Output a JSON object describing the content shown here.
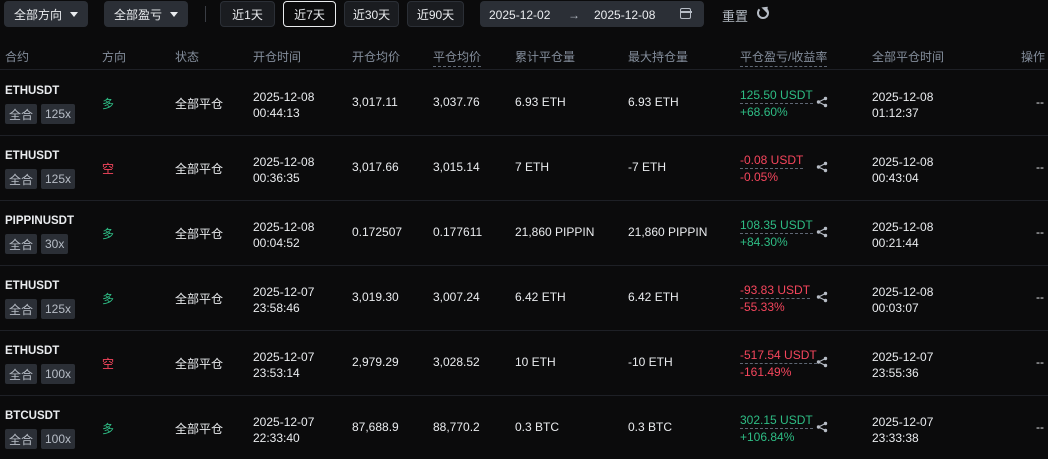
{
  "filters": {
    "direction": "全部方向",
    "pnl": "全部盈亏",
    "ranges": [
      "近1天",
      "近7天",
      "近30天",
      "近90天"
    ],
    "active_range": "近7天",
    "date_start": "2025-12-02",
    "date_end": "2025-12-08",
    "reset": "重置"
  },
  "headers": {
    "contract": "合约",
    "direction": "方向",
    "status": "状态",
    "open_time": "开仓时间",
    "open_avg": "开仓均价",
    "close_avg": "平仓均价",
    "cum_close_qty": "累计平仓量",
    "max_hold_qty": "最大持仓量",
    "close_pnl": "平仓盈亏/收益率",
    "full_close_time": "全部平仓时间",
    "action": "操作"
  },
  "rows": [
    {
      "symbol": "ETHUSDT",
      "margin": "全合",
      "leverage": "125x",
      "direction": "多",
      "side": "long",
      "status": "全部平仓",
      "open_date": "2025-12-08",
      "open_time": "00:44:13",
      "open_avg": "3,017.11",
      "close_avg": "3,037.76",
      "cum_qty": "6.93 ETH",
      "max_qty": "6.93 ETH",
      "pnl": "125.50 USDT",
      "roi": "+68.60%",
      "pnl_sign": "pos",
      "close_date": "2025-12-08",
      "close_time": "01:12:37",
      "action": "--"
    },
    {
      "symbol": "ETHUSDT",
      "margin": "全合",
      "leverage": "125x",
      "direction": "空",
      "side": "short",
      "status": "全部平仓",
      "open_date": "2025-12-08",
      "open_time": "00:36:35",
      "open_avg": "3,017.66",
      "close_avg": "3,015.14",
      "cum_qty": "7 ETH",
      "max_qty": "-7 ETH",
      "pnl": "-0.08 USDT",
      "roi": "-0.05%",
      "pnl_sign": "neg",
      "close_date": "2025-12-08",
      "close_time": "00:43:04",
      "action": "--"
    },
    {
      "symbol": "PIPPINUSDT",
      "margin": "全合",
      "leverage": "30x",
      "direction": "多",
      "side": "long",
      "status": "全部平仓",
      "open_date": "2025-12-08",
      "open_time": "00:04:52",
      "open_avg": "0.172507",
      "close_avg": "0.177611",
      "cum_qty": "21,860 PIPPIN",
      "max_qty": "21,860 PIPPIN",
      "pnl": "108.35 USDT",
      "roi": "+84.30%",
      "pnl_sign": "pos",
      "close_date": "2025-12-08",
      "close_time": "00:21:44",
      "action": "--"
    },
    {
      "symbol": "ETHUSDT",
      "margin": "全合",
      "leverage": "125x",
      "direction": "多",
      "side": "long",
      "status": "全部平仓",
      "open_date": "2025-12-07",
      "open_time": "23:58:46",
      "open_avg": "3,019.30",
      "close_avg": "3,007.24",
      "cum_qty": "6.42 ETH",
      "max_qty": "6.42 ETH",
      "pnl": "-93.83 USDT",
      "roi": "-55.33%",
      "pnl_sign": "neg",
      "close_date": "2025-12-08",
      "close_time": "00:03:07",
      "action": "--"
    },
    {
      "symbol": "ETHUSDT",
      "margin": "全合",
      "leverage": "100x",
      "direction": "空",
      "side": "short",
      "status": "全部平仓",
      "open_date": "2025-12-07",
      "open_time": "23:53:14",
      "open_avg": "2,979.29",
      "close_avg": "3,028.52",
      "cum_qty": "10 ETH",
      "max_qty": "-10 ETH",
      "pnl": "-517.54 USDT",
      "roi": "-161.49%",
      "pnl_sign": "neg",
      "close_date": "2025-12-07",
      "close_time": "23:55:36",
      "action": "--"
    },
    {
      "symbol": "BTCUSDT",
      "margin": "全合",
      "leverage": "100x",
      "direction": "多",
      "side": "long",
      "status": "全部平仓",
      "open_date": "2025-12-07",
      "open_time": "22:33:40",
      "open_avg": "87,688.9",
      "close_avg": "88,770.2",
      "cum_qty": "0.3 BTC",
      "max_qty": "0.3 BTC",
      "pnl": "302.15 USDT",
      "roi": "+106.84%",
      "pnl_sign": "pos",
      "close_date": "2025-12-07",
      "close_time": "23:33:38",
      "action": "--"
    }
  ],
  "colors": {
    "positive": "#2ebd85",
    "negative": "#f6465d",
    "background": "#0b0b0c"
  }
}
